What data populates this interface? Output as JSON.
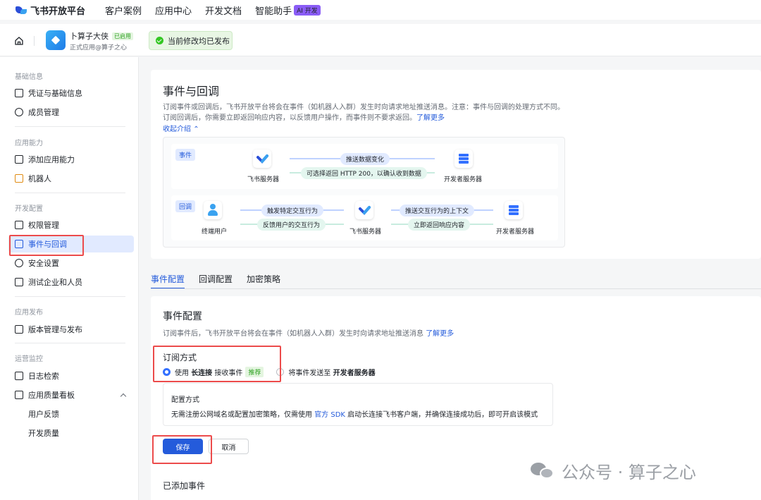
{
  "topnav": {
    "logo": "飞书开放平台",
    "items": [
      "客户案例",
      "应用中心",
      "开发文档",
      "智能助手"
    ],
    "ai_badge": "AI 开发"
  },
  "app": {
    "name": "卜算子大侠",
    "status_badge": "已启用",
    "subtitle": "正式应用@算子之心",
    "publish_status": "当前修改均已发布"
  },
  "sidebar": {
    "groups": [
      {
        "title": "基础信息",
        "items": [
          "凭证与基础信息",
          "成员管理"
        ]
      },
      {
        "title": "应用能力",
        "items": [
          "添加应用能力",
          "机器人"
        ]
      },
      {
        "title": "开发配置",
        "items": [
          "权限管理",
          "事件与回调",
          "安全设置",
          "测试企业和人员"
        ]
      },
      {
        "title": "应用发布",
        "items": [
          "版本管理与发布"
        ]
      },
      {
        "title": "运营监控",
        "items": [
          "日志检索",
          "应用质量看板",
          "用户反馈",
          "开发质量"
        ]
      }
    ],
    "active_item": "事件与回调"
  },
  "intro": {
    "title": "事件与回调",
    "desc_line1": "订阅事件或回调后，飞书开放平台将会在事件（如机器人入群）发生时向请求地址推送消息。注意：事件与回调的处理方式不同。",
    "desc_line2": "订阅回调后，你需要立即返回响应内容，以反馈用户操作，而事件则不要求返回。",
    "learn_more": "了解更多",
    "collapse": "收起介绍"
  },
  "diagram": {
    "event": {
      "tag": "事件",
      "from": "飞书服务器",
      "to": "开发者服务器",
      "push": "推送数据变化",
      "reply": "可选择返回 HTTP 200，以确认收到数据"
    },
    "callback": {
      "tag": "回调",
      "user": "终端用户",
      "server": "飞书服务器",
      "dev": "开发者服务器",
      "trigger": "触发特定交互行为",
      "feedback": "反馈用户的交互行为",
      "push_ctx": "推送交互行为的上下文",
      "reply_now": "立即返回响应内容"
    }
  },
  "tabs": [
    "事件配置",
    "回调配置",
    "加密策略"
  ],
  "event_config": {
    "title": "事件配置",
    "desc": "订阅事件后，飞书开放平台将会在事件（如机器人入群）发生时向请求地址推送消息",
    "learn_more": "了解更多",
    "subscribe_title": "订阅方式",
    "opt1_prefix": "使用",
    "opt1_bold": "长连接",
    "opt1_suffix": "接收事件",
    "opt1_badge": "推荐",
    "opt2_prefix": "将事件发送至",
    "opt2_bold": "开发者服务器",
    "cfg_title": "配置方式",
    "cfg_text_pre": "无需注册公网域名或配置加密策略，仅需使用",
    "cfg_link": "官方 SDK",
    "cfg_text_post": "启动长连接飞书客户端，并确保连接成功后，即可开启该模式",
    "save": "保存",
    "cancel": "取消",
    "added_events": "已添加事件"
  },
  "watermark": "公众号 · 算子之心",
  "colors": {
    "accent": "#245bdb",
    "success": "#34c724",
    "highlight": "#ec4b4b"
  }
}
